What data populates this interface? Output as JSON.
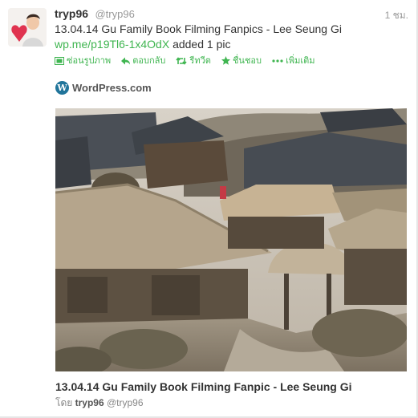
{
  "tweet": {
    "username": "tryp96",
    "handle": "@tryp96",
    "time": "1 ชม.",
    "text": "13.04.14 Gu Family Book Filming Fanpics - Lee Seung Gi",
    "link": "wp.me/p19Tl6-1x4OdX",
    "link_suffix": " added 1 pic"
  },
  "actions": {
    "hide_photo": "ซ่อนรูปภาพ",
    "reply": "ตอบกลับ",
    "retweet": "รีทวีต",
    "favorite": "ชื่นชอบ",
    "more": "เพิ่มเติม"
  },
  "card": {
    "source": "WordPress.com",
    "title": "13.04.14 Gu Family Book Filming Fanpic - Lee Seung Gi",
    "by_label": "โดย",
    "author": "tryp96",
    "author_handle": "@tryp96"
  },
  "colors": {
    "link": "#3fb550",
    "text": "#333333",
    "muted": "#999999",
    "wordpress_blue": "#21759b"
  },
  "icons": [
    "photo-icon",
    "reply-icon",
    "retweet-icon",
    "star-icon",
    "more-icon",
    "wordpress-icon",
    "heart-icon"
  ]
}
